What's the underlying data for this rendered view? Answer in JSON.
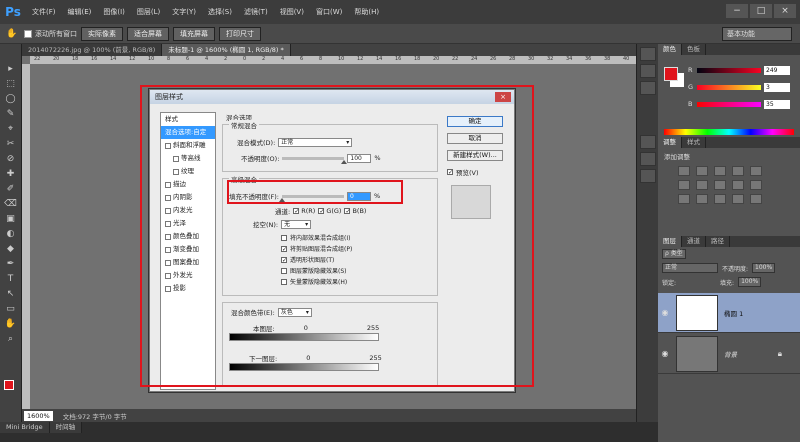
{
  "app": {
    "logo": "Ps",
    "menus": [
      "文件(F)",
      "编辑(E)",
      "图像(I)",
      "图层(L)",
      "文字(Y)",
      "选择(S)",
      "滤镜(T)",
      "视图(V)",
      "窗口(W)",
      "帮助(H)"
    ],
    "window_controls": [
      "−",
      "□",
      "×"
    ]
  },
  "options_bar": {
    "scroll_all_label": "滚动所有窗口",
    "actual_pixels": "实际像素",
    "fit_screen": "适合屏幕",
    "fill_screen": "填充屏幕",
    "print_size": "打印尺寸",
    "workspace": "基本功能"
  },
  "doc_tabs": [
    {
      "label": "2014072226.jpg @ 100% (前景, RGB/8)",
      "active": false
    },
    {
      "label": "未标题-1 @ 1600% (椭圆 1, RGB/8) *",
      "active": true
    }
  ],
  "tools": [
    "▸",
    "⬚",
    "◯",
    "✎",
    "⌖",
    "✂",
    "⊘",
    "✚",
    "✐",
    "⌫",
    "▣",
    "◐",
    "◆",
    "✒",
    "T",
    "↖",
    "▭",
    "✋",
    "⌕"
  ],
  "ruler_marks": [
    "22",
    "20",
    "18",
    "16",
    "14",
    "12",
    "10",
    "8",
    "6",
    "4",
    "2",
    "0",
    "2",
    "4",
    "6",
    "8",
    "10",
    "12",
    "14",
    "16",
    "18",
    "20",
    "22",
    "24",
    "26",
    "28",
    "30",
    "32",
    "34",
    "36",
    "38",
    "40"
  ],
  "status": {
    "zoom": "1600%",
    "doc_info": "文档:972 字节/0 字节"
  },
  "bottom_tabs": [
    "Mini Bridge",
    "时间轴"
  ],
  "color_panel": {
    "tabs": [
      "颜色",
      "色板"
    ],
    "sliders": [
      {
        "label": "R",
        "value": "249"
      },
      {
        "label": "G",
        "value": "3"
      },
      {
        "label": "B",
        "value": "35"
      }
    ],
    "fg": "#e0141c"
  },
  "adjust_panel": {
    "tabs": [
      "调整",
      "样式"
    ],
    "title": "添加调整"
  },
  "layers_panel": {
    "tabs": [
      "图层",
      "通道",
      "路径"
    ],
    "filter": "ρ 类型",
    "blend": "正常",
    "opacity_label": "不透明度:",
    "opacity": "100%",
    "fill_label": "填充:",
    "fill": "100%",
    "lock_label": "锁定:",
    "layers": [
      {
        "name": "椭圆 1",
        "selected": true
      },
      {
        "name": "背景",
        "selected": false
      }
    ]
  },
  "dialog": {
    "title": "图层样式",
    "close": "×",
    "styles_header": "样式",
    "styles": [
      {
        "label": "混合选项:自定",
        "selected": true,
        "checkbox": false,
        "indent": false
      },
      {
        "label": "斜面和浮雕",
        "selected": false,
        "checkbox": true,
        "indent": false
      },
      {
        "label": "等高线",
        "selected": false,
        "checkbox": true,
        "indent": true
      },
      {
        "label": "纹理",
        "selected": false,
        "checkbox": true,
        "indent": true
      },
      {
        "label": "描边",
        "selected": false,
        "checkbox": true,
        "indent": false
      },
      {
        "label": "内阴影",
        "selected": false,
        "checkbox": true,
        "indent": false
      },
      {
        "label": "内发光",
        "selected": false,
        "checkbox": true,
        "indent": false
      },
      {
        "label": "光泽",
        "selected": false,
        "checkbox": true,
        "indent": false
      },
      {
        "label": "颜色叠加",
        "selected": false,
        "checkbox": true,
        "indent": false
      },
      {
        "label": "渐变叠加",
        "selected": false,
        "checkbox": true,
        "indent": false
      },
      {
        "label": "图案叠加",
        "selected": false,
        "checkbox": true,
        "indent": false
      },
      {
        "label": "外发光",
        "selected": false,
        "checkbox": true,
        "indent": false
      },
      {
        "label": "投影",
        "selected": false,
        "checkbox": true,
        "indent": false
      }
    ],
    "blend_options_title": "混合选项",
    "general_title": "常规混合",
    "blend_mode_label": "混合模式(D):",
    "blend_mode": "正常",
    "opacity_label": "不透明度(O):",
    "opacity_value": "100",
    "pct": "%",
    "opacity_level": 1.0,
    "advanced_title": "高级混合",
    "fill_opacity_label": "填充不透明度(F):",
    "fill_opacity_value": "0",
    "fill_opacity_level": 0.0,
    "channels_label": "通道:",
    "channels": [
      "R(R)",
      "G(G)",
      "B(B)"
    ],
    "knockout_label": "挖空(N):",
    "knockout": "无",
    "checks": [
      {
        "label": "将内部效果混合成组(I)",
        "checked": false
      },
      {
        "label": "将剪贴图层混合成组(P)",
        "checked": true
      },
      {
        "label": "透明形状图层(T)",
        "checked": true
      },
      {
        "label": "图层蒙版隐藏效果(S)",
        "checked": false
      },
      {
        "label": "矢量蒙版隐藏效果(H)",
        "checked": false
      }
    ],
    "blend_if_label": "混合颜色带(E):",
    "blend_if": "灰色",
    "this_layer_label": "本图层:",
    "this_layer_min": "0",
    "this_layer_max": "255",
    "underlying_label": "下一图层:",
    "underlying_min": "0",
    "underlying_max": "255",
    "buttons": {
      "ok": "确定",
      "cancel": "取消",
      "new_style": "新建样式(W)...",
      "preview": "预览(V)",
      "preview_checked": true
    }
  }
}
